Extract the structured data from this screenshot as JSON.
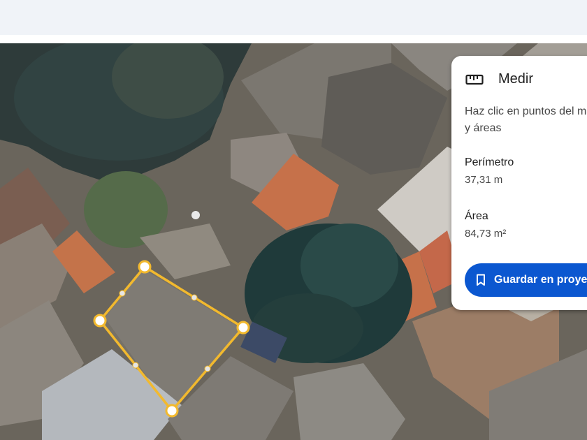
{
  "measure": {
    "title": "Medir",
    "hint_lines": [
      "Haz clic en puntos del mapa para medir distancias",
      "y áreas"
    ],
    "perimeter_label": "Perímetro",
    "perimeter_value": "37,31 m",
    "area_label": "Área",
    "area_value": "84,73 m²",
    "save_label": "Guardar en proyecto",
    "icons": {
      "title": "ruler-icon",
      "save": "bookmark-icon"
    },
    "colors": {
      "accent": "#0b57d0",
      "polygon": "#f2b92e"
    }
  }
}
